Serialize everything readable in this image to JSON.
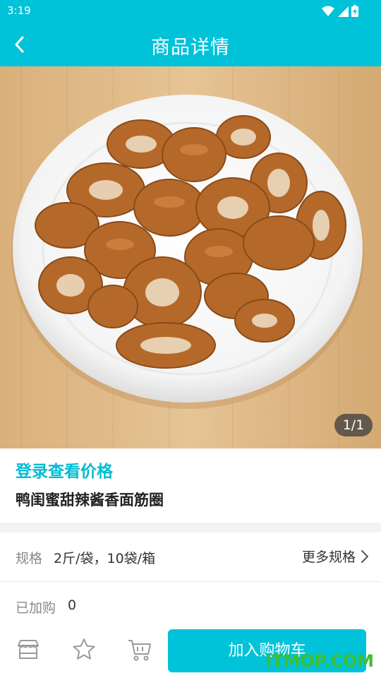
{
  "status_bar": {
    "time": "3:19"
  },
  "header": {
    "title": "商品详情"
  },
  "gallery": {
    "pager": "1/1"
  },
  "product": {
    "login_price": "登录查看价格",
    "name": "鸭闺蜜甜辣酱香面筋圈"
  },
  "spec": {
    "label": "规格",
    "value": "2斤/袋，10袋/箱",
    "more": "更多规格"
  },
  "cart_status": {
    "label": "已加购",
    "count": "0"
  },
  "bottom_bar": {
    "add_to_cart": "加入购物车"
  },
  "watermark": "ITMOP.COM",
  "colors": {
    "accent": "#00c2d9",
    "price_text": "#00bcd4"
  }
}
